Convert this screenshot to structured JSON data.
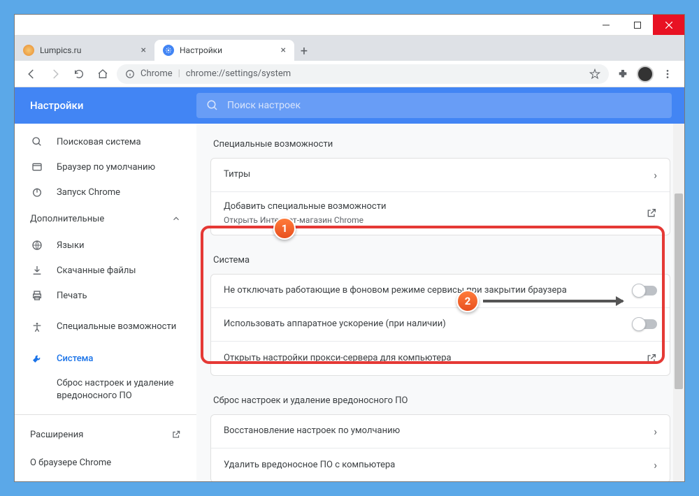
{
  "window": {
    "tabs": [
      {
        "title": "Lumpics.ru",
        "favicon_color": "#f5a623",
        "active": false
      },
      {
        "title": "Настройки",
        "favicon_color": "#4285f4",
        "active": true
      }
    ]
  },
  "addressbar": {
    "scheme_label": "Chrome",
    "url": "chrome://settings/system"
  },
  "header": {
    "title": "Настройки",
    "search_placeholder": "Поиск настроек"
  },
  "sidebar": {
    "items": [
      {
        "icon": "search",
        "label": "Поисковая система"
      },
      {
        "icon": "browser",
        "label": "Браузер по умолчанию"
      },
      {
        "icon": "power",
        "label": "Запуск Chrome"
      }
    ],
    "advanced_label": "Дополнительные",
    "advanced_items": [
      {
        "icon": "globe",
        "label": "Языки"
      },
      {
        "icon": "download",
        "label": "Скачанные файлы"
      },
      {
        "icon": "print",
        "label": "Печать"
      },
      {
        "icon": "accessibility",
        "label": "Специальные возможности"
      },
      {
        "icon": "wrench",
        "label": "Система",
        "active": true
      },
      {
        "icon": "",
        "label": "Сброс настроек и удаление вредоносного ПО"
      }
    ],
    "extensions_label": "Расширения",
    "about_label": "О браузере Chrome"
  },
  "main": {
    "accessibility": {
      "title": "Специальные возможности",
      "rows": [
        {
          "label": "Титры",
          "action": "chevron"
        },
        {
          "label": "Добавить специальные возможности",
          "sub": "Открыть Интернет-магазин Chrome",
          "action": "external"
        }
      ]
    },
    "system": {
      "title": "Система",
      "rows": [
        {
          "label": "Не отключать работающие в фоновом режиме сервисы при закрытии браузера",
          "action": "toggle"
        },
        {
          "label": "Использовать аппаратное ускорение (при наличии)",
          "action": "toggle"
        },
        {
          "label": "Открыть настройки прокси-сервера для компьютера",
          "action": "external"
        }
      ]
    },
    "reset": {
      "title": "Сброс настроек и удаление вредоносного ПО",
      "rows": [
        {
          "label": "Восстановление настроек по умолчанию",
          "action": "chevron"
        },
        {
          "label": "Удалить вредоносное ПО с компьютера",
          "action": "chevron"
        }
      ]
    }
  },
  "callouts": {
    "one": "1",
    "two": "2"
  }
}
